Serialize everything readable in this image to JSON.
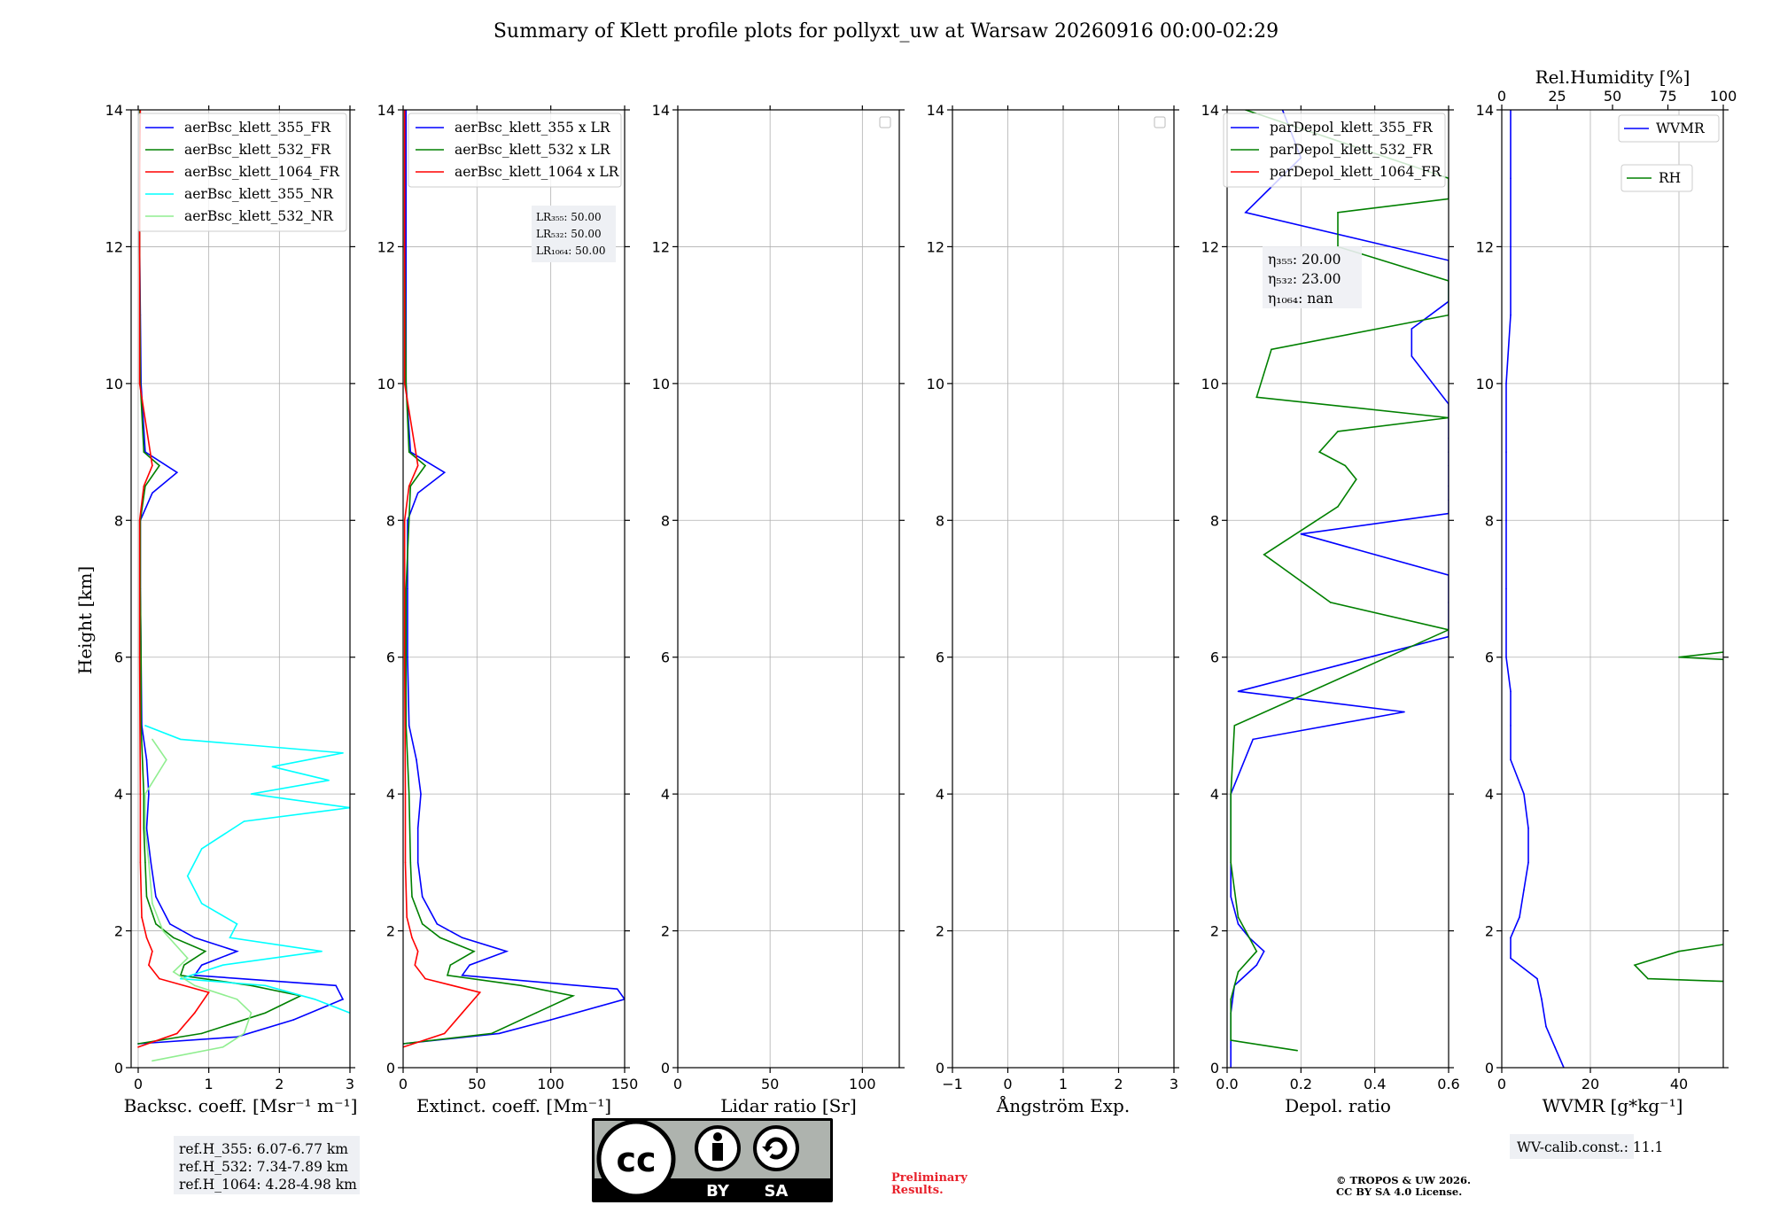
{
  "title": "Summary of Klett profile plots for pollyxt_uw at Warsaw 20260916 00:00-02:29",
  "y_axis_label": "Height [km]",
  "y_ticks": [
    "0",
    "2",
    "4",
    "6",
    "8",
    "10",
    "12",
    "14"
  ],
  "chart_data": [
    {
      "id": "backscatter",
      "type": "line",
      "xlabel": "Backsc. coeff. [Msr⁻¹ m⁻¹]",
      "xlim": [
        -0.1,
        3
      ],
      "ylim": [
        0,
        14
      ],
      "xticks": [
        "0",
        "1",
        "2",
        "3"
      ],
      "grid": true,
      "legend_position": "top-right",
      "series": [
        {
          "name": "aerBsc_klett_355_FR",
          "color": "#0000ff",
          "height_km": [
            0.35,
            0.45,
            0.7,
            1.0,
            1.2,
            1.35,
            1.5,
            1.7,
            1.9,
            2.1,
            2.5,
            3.0,
            3.5,
            4.0,
            4.5,
            5.0,
            6.0,
            7.0,
            8.0,
            8.4,
            8.7,
            9.0,
            10.0,
            11.0,
            12.0,
            13.0,
            14.0
          ],
          "values": [
            0.0,
            1.4,
            2.2,
            2.9,
            2.8,
            0.8,
            0.9,
            1.4,
            0.8,
            0.45,
            0.25,
            0.18,
            0.12,
            0.15,
            0.12,
            0.05,
            0.04,
            0.03,
            0.03,
            0.2,
            0.55,
            0.1,
            0.04,
            0.03,
            0.02,
            0.02,
            0.02
          ]
        },
        {
          "name": "aerBsc_klett_532_FR",
          "color": "#008000",
          "height_km": [
            0.35,
            0.5,
            0.8,
            1.05,
            1.2,
            1.35,
            1.5,
            1.7,
            1.9,
            2.1,
            2.5,
            3.0,
            3.5,
            4.0,
            5.0,
            6.0,
            7.0,
            8.0,
            8.5,
            8.8,
            9.0,
            10.0,
            12.0,
            14.0
          ],
          "values": [
            0.0,
            0.9,
            1.8,
            2.3,
            1.6,
            0.6,
            0.65,
            0.95,
            0.5,
            0.25,
            0.12,
            0.1,
            0.08,
            0.08,
            0.04,
            0.04,
            0.03,
            0.03,
            0.1,
            0.3,
            0.08,
            0.03,
            0.02,
            0.02
          ]
        },
        {
          "name": "aerBsc_klett_1064_FR",
          "color": "#ff0000",
          "height_km": [
            0.3,
            0.5,
            0.8,
            1.1,
            1.3,
            1.5,
            1.7,
            1.9,
            2.2,
            3.0,
            4.0,
            6.0,
            8.0,
            8.5,
            8.8,
            10.0,
            12.0,
            13.0,
            14.0
          ],
          "values": [
            0.0,
            0.55,
            0.8,
            1.0,
            0.3,
            0.15,
            0.2,
            0.12,
            0.05,
            0.03,
            0.03,
            0.02,
            0.02,
            0.08,
            0.2,
            0.02,
            0.02,
            0.02,
            0.03
          ]
        },
        {
          "name": "aerBsc_klett_355_NR",
          "color": "#00ffff",
          "height_km": [
            0.8,
            1.0,
            1.2,
            1.3,
            1.5,
            1.7,
            1.9,
            2.1,
            2.4,
            2.8,
            3.2,
            3.6,
            3.8,
            4.0,
            4.2,
            4.4,
            4.6,
            4.8,
            5.0
          ],
          "values": [
            3.0,
            2.5,
            1.8,
            0.6,
            1.2,
            2.6,
            1.3,
            1.4,
            0.9,
            0.7,
            0.9,
            1.5,
            3.0,
            1.6,
            2.7,
            1.9,
            2.9,
            0.6,
            0.1
          ]
        },
        {
          "name": "aerBsc_klett_532_NR",
          "color": "#90ee90",
          "height_km": [
            0.1,
            0.3,
            0.5,
            0.8,
            1.0,
            1.2,
            1.4,
            1.6,
            2.0,
            2.4,
            3.0,
            3.5,
            4.0,
            4.5,
            4.8
          ],
          "values": [
            0.2,
            1.2,
            1.5,
            1.6,
            1.4,
            0.8,
            0.5,
            0.7,
            0.35,
            0.2,
            0.15,
            0.1,
            0.1,
            0.4,
            0.2
          ]
        }
      ]
    },
    {
      "id": "extinction",
      "type": "line",
      "xlabel": "Extinct. coeff. [Mm⁻¹]",
      "xlim": [
        0,
        150
      ],
      "ylim": [
        0,
        14
      ],
      "xticks": [
        "0",
        "50",
        "100",
        "150"
      ],
      "grid": true,
      "legend_position": "top-right",
      "annotation": [
        "LR₃₅₅: 50.00",
        "LR₅₃₂: 50.00",
        "LR₁₀₆₄: 50.00"
      ],
      "series": [
        {
          "name": "aerBsc_klett_355 x LR",
          "color": "#0000ff",
          "height_km": [
            0.35,
            0.5,
            0.7,
            1.0,
            1.15,
            1.35,
            1.5,
            1.7,
            1.9,
            2.1,
            2.5,
            3.0,
            3.5,
            4.0,
            4.5,
            5.0,
            6.0,
            7.0,
            8.0,
            8.4,
            8.7,
            9.0,
            10.0,
            12.0,
            14.0
          ],
          "values": [
            0,
            65,
            100,
            150,
            145,
            40,
            45,
            70,
            40,
            23,
            13,
            10,
            10,
            12,
            9,
            4,
            3,
            3,
            3,
            10,
            28,
            5,
            2,
            2,
            2
          ]
        },
        {
          "name": "aerBsc_klett_532 x LR",
          "color": "#008000",
          "height_km": [
            0.35,
            0.5,
            0.8,
            1.05,
            1.2,
            1.35,
            1.5,
            1.7,
            1.9,
            2.1,
            2.5,
            3.0,
            4.0,
            5.0,
            7.0,
            8.5,
            8.8,
            9.0,
            10.0,
            12.0,
            14.0
          ],
          "values": [
            0,
            60,
            90,
            115,
            80,
            30,
            32,
            48,
            25,
            13,
            6,
            5,
            4,
            2,
            2,
            5,
            15,
            4,
            2,
            1,
            1
          ]
        },
        {
          "name": "aerBsc_klett_1064 x LR",
          "color": "#ff0000",
          "height_km": [
            0.3,
            0.5,
            0.8,
            1.1,
            1.3,
            1.5,
            1.7,
            1.9,
            2.2,
            3.0,
            4.0,
            6.0,
            8.0,
            8.5,
            8.8,
            10.0,
            12.0,
            14.0
          ],
          "values": [
            0,
            28,
            40,
            52,
            15,
            8,
            10,
            6,
            2.5,
            1.5,
            1.5,
            1,
            1,
            4,
            10,
            1,
            1,
            1
          ]
        }
      ]
    },
    {
      "id": "lidar_ratio",
      "type": "line",
      "xlabel": "Lidar ratio [Sr]",
      "xlim": [
        0,
        120
      ],
      "ylim": [
        0,
        14
      ],
      "xticks": [
        "0",
        "50",
        "100"
      ],
      "grid": true,
      "series": []
    },
    {
      "id": "angstrom",
      "type": "line",
      "xlabel": "Ångström Exp.",
      "xlim": [
        -1,
        3
      ],
      "ylim": [
        0,
        14
      ],
      "xticks": [
        "−1",
        "0",
        "1",
        "2",
        "3"
      ],
      "grid": true,
      "series": []
    },
    {
      "id": "depol",
      "type": "line",
      "xlabel": "Depol. ratio",
      "xlim": [
        0,
        0.6
      ],
      "ylim": [
        0,
        14
      ],
      "xticks": [
        "0.0",
        "0.2",
        "0.4",
        "0.6"
      ],
      "grid": true,
      "legend_position": "top-right",
      "annotation": [
        "η₃₅₅: 20.00",
        "η₅₃₂: 23.00",
        "η₁₀₆₄: nan"
      ],
      "series": [
        {
          "name": "parDepol_klett_355_FR",
          "color": "#0000ff",
          "height_km": [
            0.0,
            0.3,
            0.8,
            1.2,
            1.5,
            1.7,
            1.9,
            2.1,
            2.5,
            3.0,
            4.0,
            4.8,
            5.2,
            5.5,
            6.3,
            6.8,
            7.2,
            7.8,
            8.1,
            8.3,
            8.5,
            8.8,
            9.0,
            9.2,
            9.5,
            9.7,
            10.4,
            10.8,
            11.2,
            11.5,
            11.8,
            12.5,
            13.3,
            14.0
          ],
          "values": [
            0.01,
            0.01,
            0.01,
            0.02,
            0.08,
            0.1,
            0.06,
            0.03,
            0.01,
            0.01,
            0.01,
            0.07,
            0.48,
            0.03,
            0.6,
            0.6,
            0.6,
            0.2,
            0.6,
            0.6,
            0.6,
            0.6,
            0.6,
            0.6,
            0.6,
            0.6,
            0.5,
            0.5,
            0.6,
            0.6,
            0.6,
            0.05,
            0.2,
            0.15
          ]
        },
        {
          "name": "parDepol_klett_532_FR",
          "color": "#008000",
          "height_km": [
            0.25,
            0.4,
            1.0,
            1.4,
            1.7,
            1.9,
            2.2,
            2.6,
            3.0,
            4.0,
            5.0,
            6.4,
            6.8,
            7.5,
            8.2,
            8.6,
            8.8,
            9.0,
            9.3,
            9.5,
            9.8,
            10.5,
            11.0,
            11.5,
            12.0,
            12.5,
            12.7,
            13.0,
            14.0
          ],
          "values": [
            0.19,
            0.01,
            0.01,
            0.03,
            0.08,
            0.06,
            0.03,
            0.02,
            0.01,
            0.01,
            0.02,
            0.6,
            0.28,
            0.1,
            0.3,
            0.35,
            0.32,
            0.25,
            0.3,
            0.6,
            0.08,
            0.12,
            0.6,
            0.6,
            0.3,
            0.3,
            0.6,
            0.6,
            0.05
          ]
        },
        {
          "name": "parDepol_klett_1064_FR",
          "color": "#ff0000",
          "height_km": [],
          "values": []
        }
      ]
    },
    {
      "id": "wvmr",
      "type": "line",
      "xlabel": "WVMR [g*kg⁻¹]",
      "xlim": [
        0,
        50
      ],
      "ylim": [
        0,
        14
      ],
      "xticks": [
        "0",
        "20",
        "40"
      ],
      "x2label": "Rel.Humidity [%]",
      "x2lim": [
        0,
        100
      ],
      "x2ticks": [
        "0",
        "25",
        "50",
        "75",
        "100"
      ],
      "grid": true,
      "series": [
        {
          "name": "WVMR",
          "color": "#0000ff",
          "height_km": [
            0.0,
            0.3,
            0.6,
            1.0,
            1.3,
            1.6,
            1.9,
            2.2,
            2.6,
            3.0,
            3.5,
            4.0,
            4.5,
            5.0,
            5.5,
            6.0,
            7.0,
            8.0,
            9.0,
            10.0,
            11.0,
            12.0,
            13.0,
            14.0
          ],
          "values": [
            14,
            12,
            10,
            9,
            8,
            2,
            2,
            4,
            5,
            6,
            6,
            5,
            2,
            2,
            2,
            1,
            1,
            1,
            1,
            1,
            2,
            2,
            2,
            2
          ]
        },
        {
          "name": "RH",
          "color": "#008000",
          "height_km": [
            0.6,
            0.9,
            1.15,
            1.3,
            1.5,
            1.7,
            2.0,
            2.3,
            2.6,
            3.0,
            3.4,
            3.8,
            4.2,
            4.6,
            5.0,
            5.4,
            5.8,
            6.0,
            6.4,
            7.0,
            7.6,
            8.2,
            8.7
          ],
          "values": [
            100,
            100,
            100,
            33,
            30,
            40,
            70,
            80,
            75,
            85,
            90,
            95,
            70,
            65,
            100,
            100,
            100,
            40,
            95,
            90,
            80,
            95,
            100
          ]
        }
      ]
    }
  ],
  "ref_heights": [
    "ref.H_355: 6.07-6.77 km",
    "ref.H_532: 7.34-7.89 km",
    "ref.H_1064: 4.28-4.98 km"
  ],
  "wv_calib": "WV-calib.const.: 11.1",
  "cc_badge": {
    "main": "cc",
    "by": "BY",
    "sa": "SA"
  },
  "preliminary": [
    "Preliminary",
    "Results."
  ],
  "copyright": [
    "© TROPOS & UW 2026.",
    "CC BY SA 4.0 License."
  ]
}
